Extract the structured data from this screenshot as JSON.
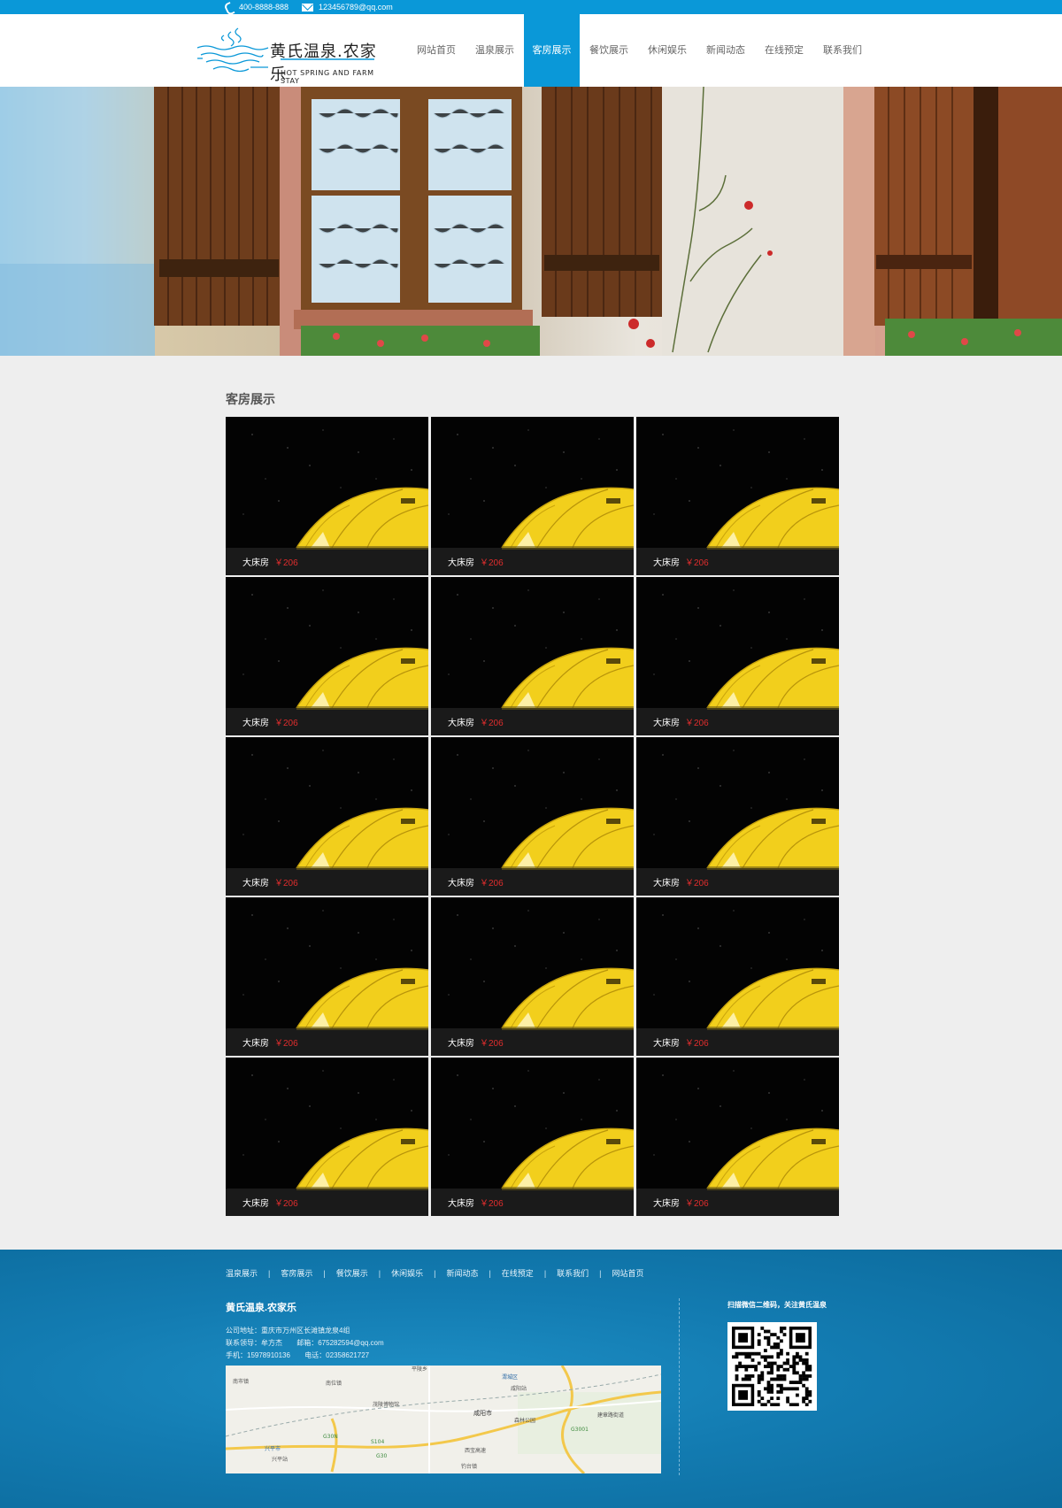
{
  "topbar": {
    "phone": "400-8888-888",
    "email": "123456789@qq.com"
  },
  "header": {
    "logo_cn": "黄氏温泉.农家乐",
    "logo_en": "HOT SPRING AND FARM STAY"
  },
  "nav": {
    "items": [
      {
        "label": "网站首页"
      },
      {
        "label": "温泉展示"
      },
      {
        "label": "客房展示",
        "active": true
      },
      {
        "label": "餐饮展示"
      },
      {
        "label": "休闲娱乐"
      },
      {
        "label": "新闻动态"
      },
      {
        "label": "在线预定"
      },
      {
        "label": "联系我们"
      }
    ]
  },
  "section": {
    "title": "客房展示"
  },
  "rooms": [
    {
      "name": "大床房",
      "price": "￥206"
    },
    {
      "name": "大床房",
      "price": "￥206"
    },
    {
      "name": "大床房",
      "price": "￥206"
    },
    {
      "name": "大床房",
      "price": "￥206"
    },
    {
      "name": "大床房",
      "price": "￥206"
    },
    {
      "name": "大床房",
      "price": "￥206"
    },
    {
      "name": "大床房",
      "price": "￥206"
    },
    {
      "name": "大床房",
      "price": "￥206"
    },
    {
      "name": "大床房",
      "price": "￥206"
    },
    {
      "name": "大床房",
      "price": "￥206"
    },
    {
      "name": "大床房",
      "price": "￥206"
    },
    {
      "name": "大床房",
      "price": "￥206"
    },
    {
      "name": "大床房",
      "price": "￥206"
    },
    {
      "name": "大床房",
      "price": "￥206"
    },
    {
      "name": "大床房",
      "price": "￥206"
    }
  ],
  "footer": {
    "links": [
      "温泉展示",
      "客房展示",
      "餐饮展示",
      "休闲娱乐",
      "新闻动态",
      "在线预定",
      "联系我们",
      "网站首页"
    ],
    "separator": "|",
    "company_name": "黄氏温泉.农家乐",
    "address": "公司地址：重庆市万州区长滩镇龙泉4组",
    "contact_person": "联系领导：牟方杰",
    "email": "邮箱：675282594@qq.com",
    "mobile": "手机：15978910136",
    "phone": "电话：02358621727",
    "qr_caption": "扫描微信二维码，关注黄氏温泉",
    "map_labels": [
      "平陵乡",
      "渭城区",
      "南市镇",
      "南位镇",
      "咸阳站",
      "茂陵博物馆",
      "咸阳市",
      "森林公园",
      "兴平市",
      "兴平站",
      "G30N",
      "S104",
      "G30",
      "G3001",
      "钓台镇",
      "西宝高速",
      "建章路街道"
    ]
  },
  "colors": {
    "brand_blue": "#0a98d8",
    "price_red": "#e02d2d",
    "page_bg": "#eeeeee"
  }
}
